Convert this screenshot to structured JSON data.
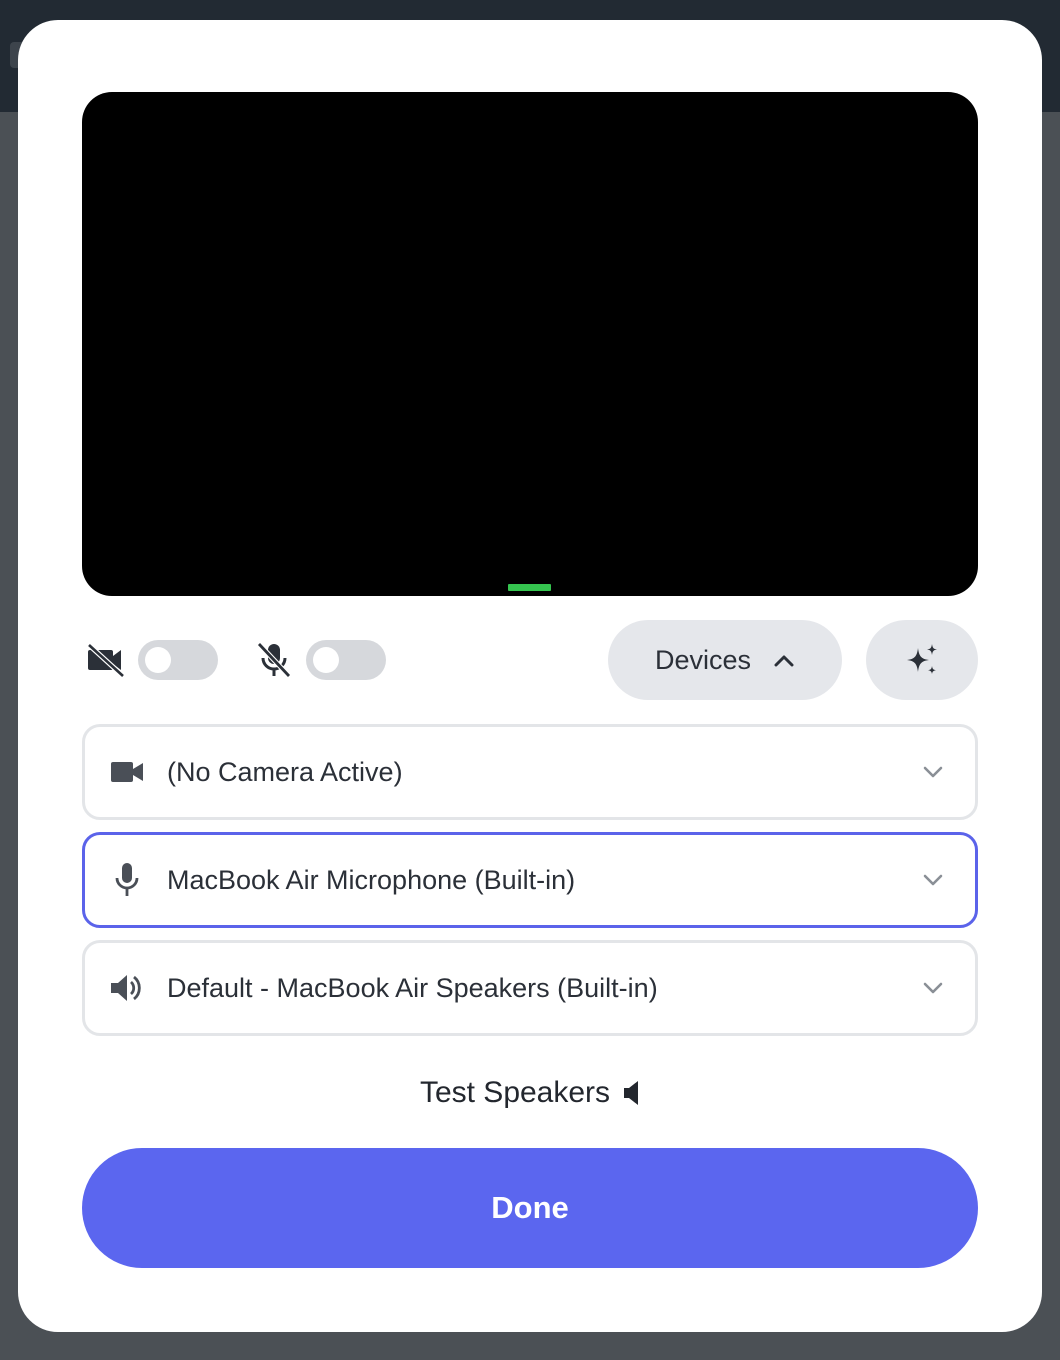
{
  "colors": {
    "accent": "#5b66ef",
    "focus_border": "#5b63ea",
    "video_indicator": "#35c44f",
    "backdrop": "#4b5055"
  },
  "preview": {
    "camera_off_icon": "video-off-icon",
    "mic_off_icon": "mic-off-icon",
    "camera_toggle_on": false,
    "mic_toggle_on": false
  },
  "toolbar": {
    "devices_label": "Devices",
    "devices_icon": "chevron-up-icon",
    "effects_icon": "sparkles-icon"
  },
  "devices": {
    "camera": {
      "icon": "video-camera-icon",
      "value": "(No Camera Active)"
    },
    "microphone": {
      "icon": "microphone-icon",
      "value": "MacBook Air Microphone (Built-in)"
    },
    "speaker": {
      "icon": "speaker-icon",
      "value": "Default - MacBook Air Speakers (Built-in)"
    }
  },
  "test_speakers": {
    "label": "Test Speakers",
    "icon": "speaker-small-icon"
  },
  "done_label": "Done"
}
